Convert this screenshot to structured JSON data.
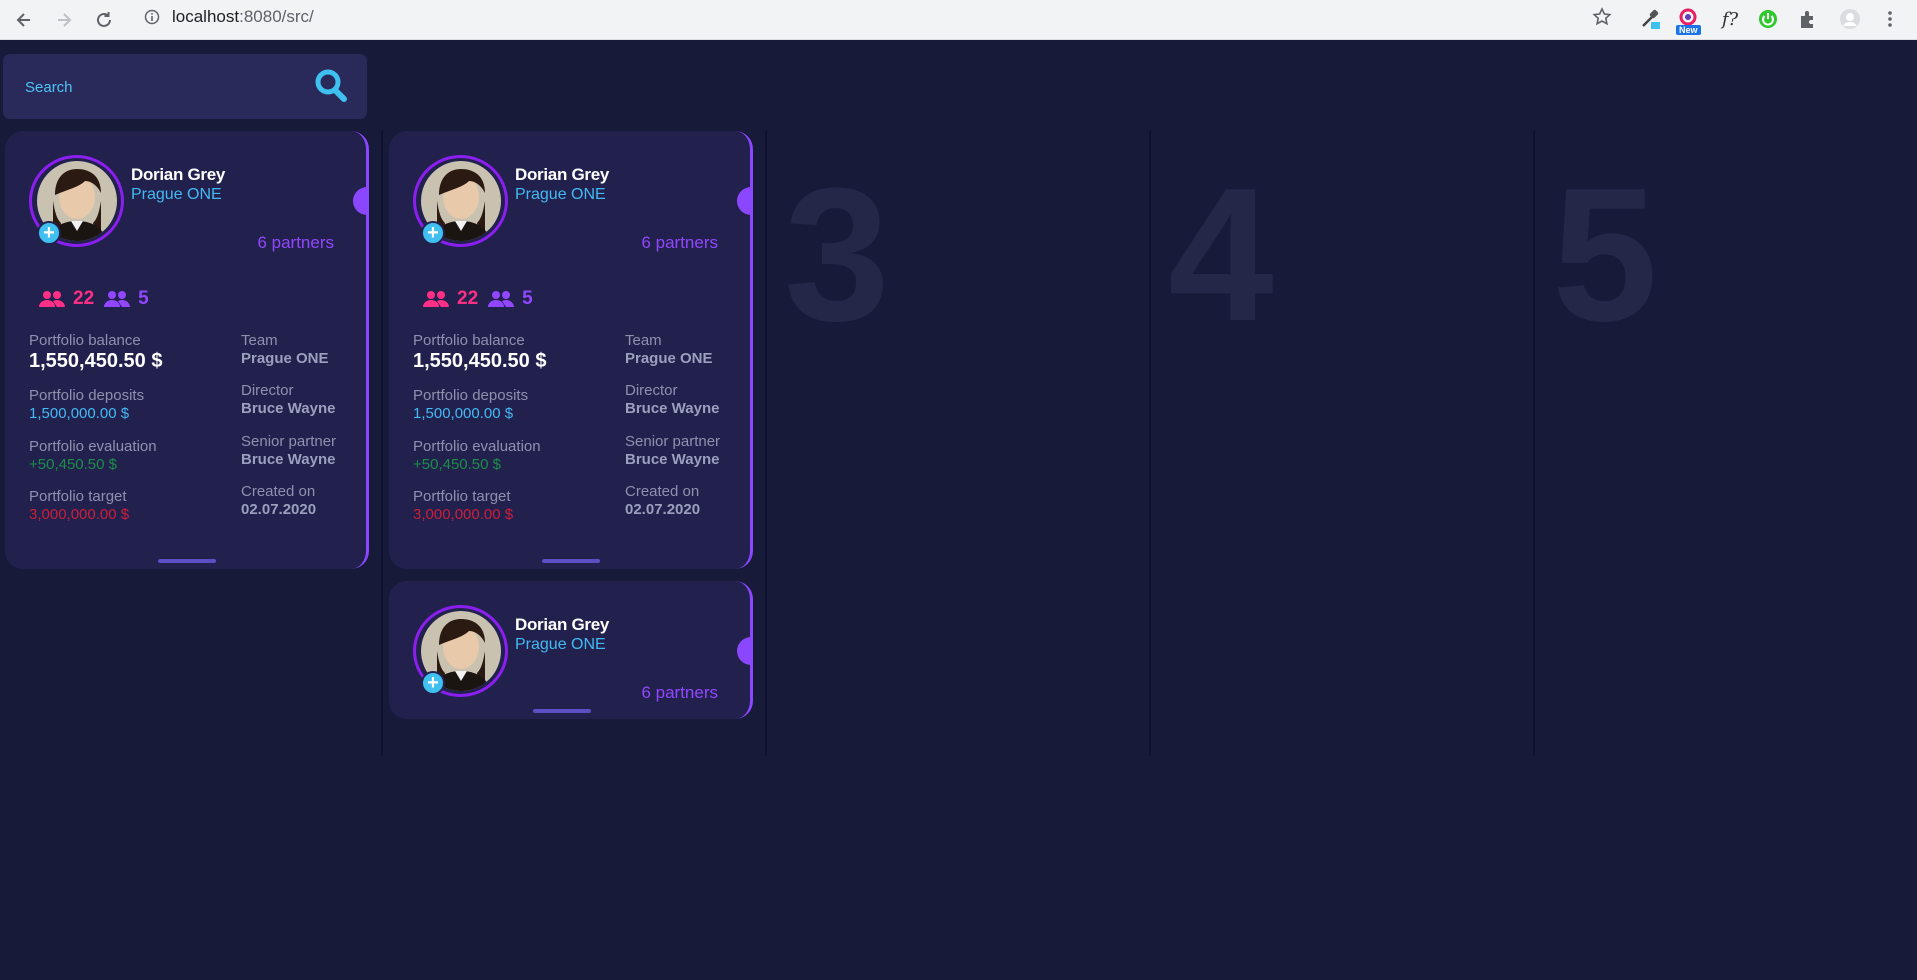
{
  "browser": {
    "url_host": "localhost",
    "url_rest": ":8080/src/",
    "new_badge": "New",
    "fx_label": "f?"
  },
  "search": {
    "placeholder": "Search"
  },
  "columns": [
    {
      "number": "3"
    },
    {
      "number": "4"
    },
    {
      "number": "5"
    }
  ],
  "card": {
    "name": "Dorian Grey",
    "team": "Prague ONE",
    "partners": "6 partners",
    "stat_a": "22",
    "stat_b": "5",
    "portfolio_balance_label": "Portfolio balance",
    "portfolio_balance": "1,550,450.50 $",
    "portfolio_deposits_label": "Portfolio deposits",
    "portfolio_deposits": "1,500,000.00 $",
    "portfolio_evaluation_label": "Portfolio evaluation",
    "portfolio_evaluation": "+50,450.50 $",
    "portfolio_target_label": "Portfolio target",
    "portfolio_target": "3,000,000.00 $",
    "team_label": "Team",
    "team_value": "Prague ONE",
    "director_label": "Director",
    "director": "Bruce Wayne",
    "senior_partner_label": "Senior partner",
    "senior_partner": "Bruce Wayne",
    "created_on_label": "Created on",
    "created_on": "02.07.2020"
  },
  "colors": {
    "background": "#171a38",
    "card": "#22214d",
    "accent_purple": "#8b46ff",
    "accent_blue": "#43b9f3",
    "pink": "#ff2f85",
    "green": "#1b8e48",
    "red": "#cc1e3b"
  }
}
